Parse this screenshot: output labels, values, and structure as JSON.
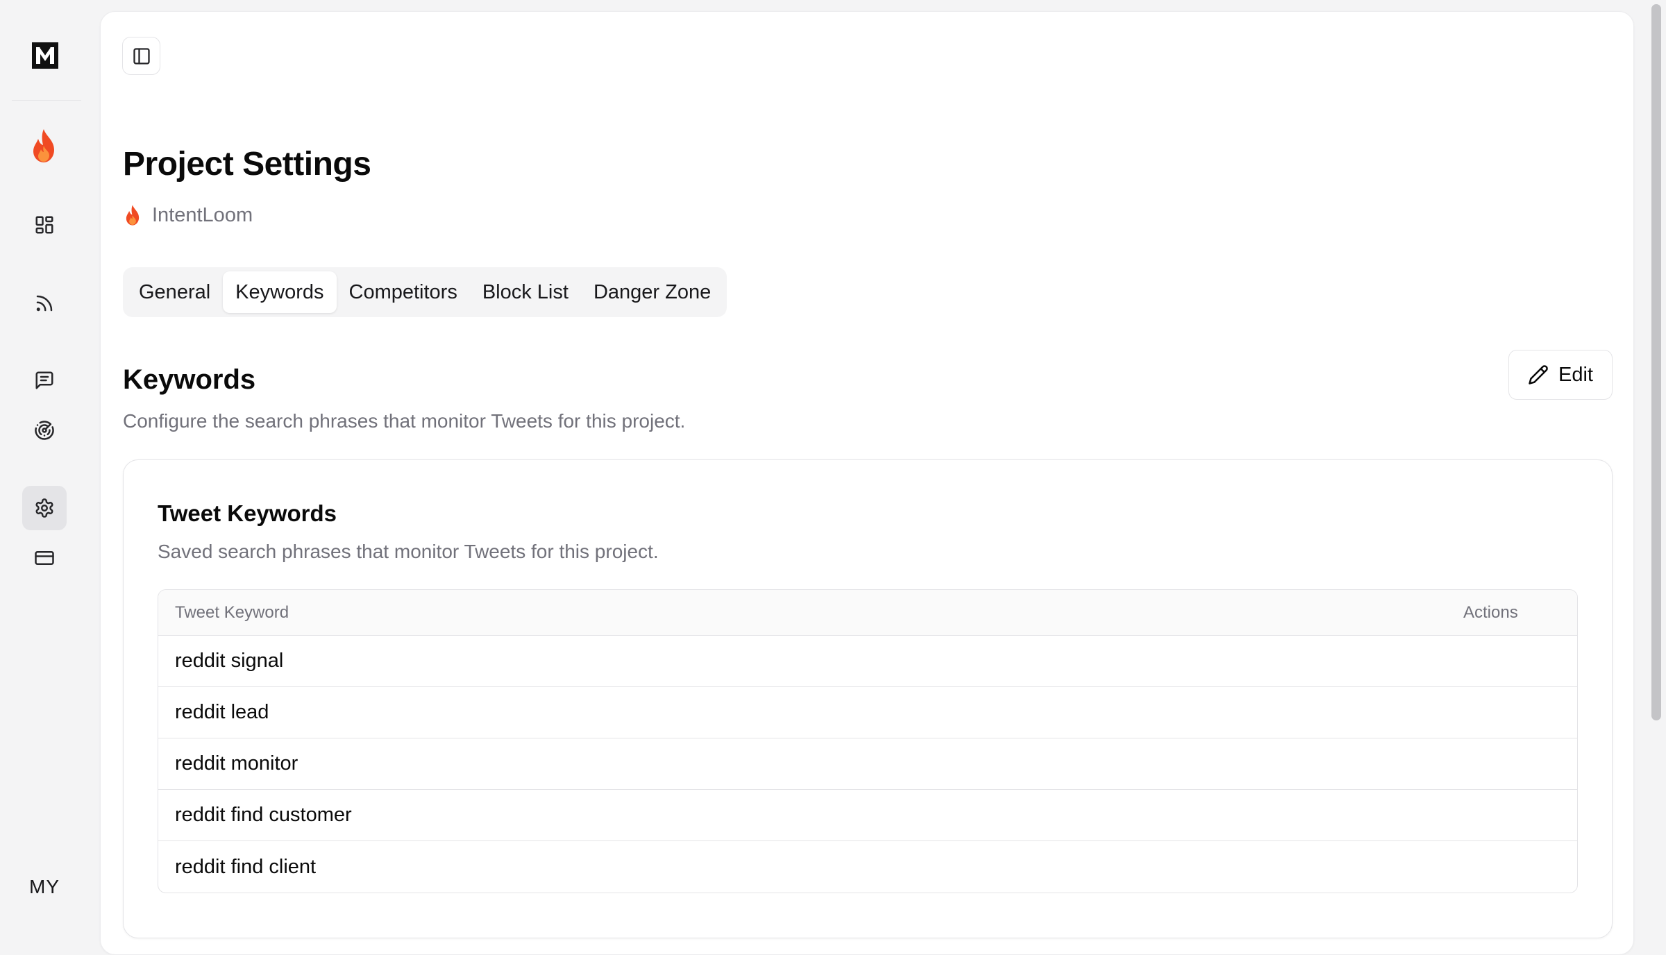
{
  "rail": {
    "user_initials": "MY",
    "icons": {
      "logo": "app-logo-icon",
      "project": "flame-icon",
      "dashboard": "layout-grid-icon",
      "feed": "rss-icon",
      "messages": "message-square-icon",
      "radar": "radar-icon",
      "settings": "settings-gear-icon",
      "billing": "credit-card-icon"
    },
    "active_item": "settings"
  },
  "header": {
    "title": "Project Settings",
    "project_name": "IntentLoom"
  },
  "tabs": [
    {
      "label": "General",
      "active": false
    },
    {
      "label": "Keywords",
      "active": true
    },
    {
      "label": "Competitors",
      "active": false
    },
    {
      "label": "Block List",
      "active": false
    },
    {
      "label": "Danger Zone",
      "active": false
    }
  ],
  "section": {
    "title": "Keywords",
    "description": "Configure the search phrases that monitor Tweets for this project.",
    "edit_label": "Edit"
  },
  "card": {
    "title": "Tweet Keywords",
    "description": "Saved search phrases that monitor Tweets for this project.",
    "table": {
      "headers": {
        "keyword": "Tweet Keyword",
        "actions": "Actions"
      },
      "rows": [
        {
          "keyword": "reddit signal"
        },
        {
          "keyword": "reddit lead"
        },
        {
          "keyword": "reddit monitor"
        },
        {
          "keyword": "reddit find customer"
        },
        {
          "keyword": "reddit find client"
        }
      ]
    }
  },
  "colors": {
    "accent_flame": "#ef4444",
    "muted_text": "#71717a",
    "border": "#e4e4e7",
    "background": "#f4f4f5"
  }
}
